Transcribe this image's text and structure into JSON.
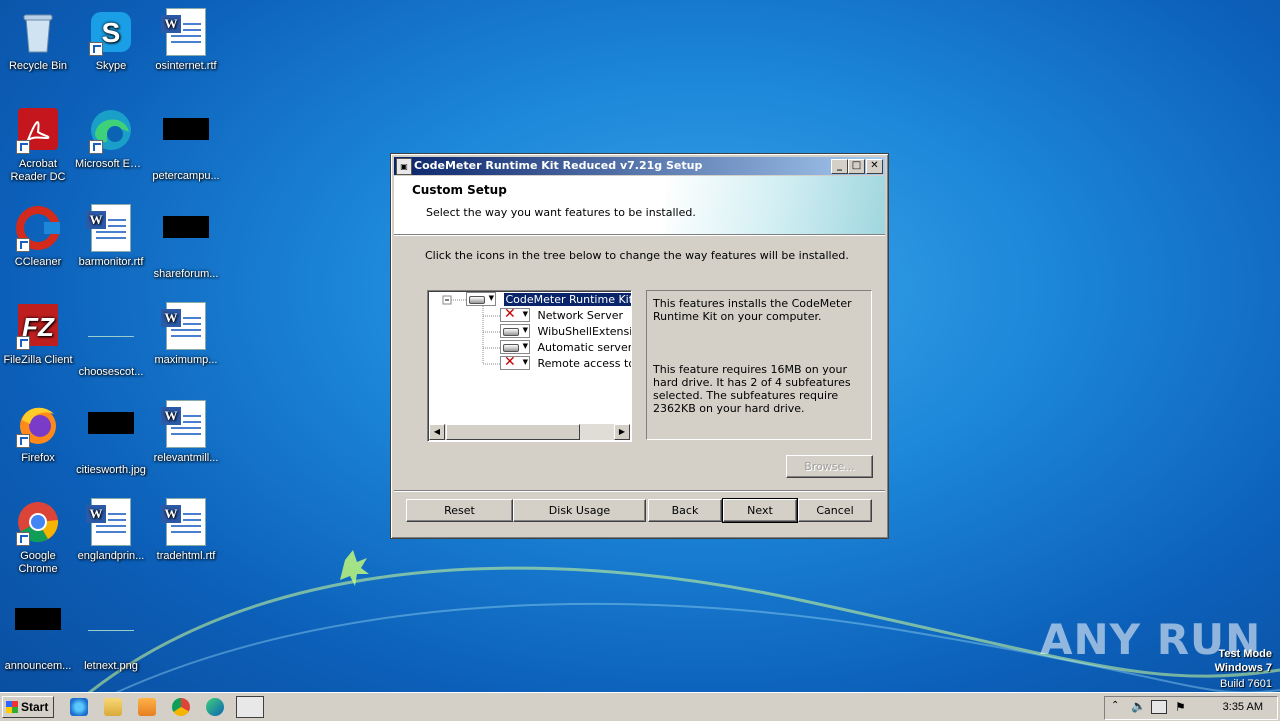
{
  "desktop": {
    "icons": [
      {
        "label": "Recycle Bin"
      },
      {
        "label": "Skype"
      },
      {
        "label": "osinternet.rtf"
      },
      {
        "label": "Acrobat Reader DC"
      },
      {
        "label": "Microsoft Edge"
      },
      {
        "label": "petercampu..."
      },
      {
        "label": "CCleaner"
      },
      {
        "label": "barmonitor.rtf"
      },
      {
        "label": "shareforum..."
      },
      {
        "label": "FileZilla Client"
      },
      {
        "label": "choosescot..."
      },
      {
        "label": "maximump..."
      },
      {
        "label": "Firefox"
      },
      {
        "label": "citiesworth.jpg"
      },
      {
        "label": "relevantmill..."
      },
      {
        "label": "Google Chrome"
      },
      {
        "label": "englandprin..."
      },
      {
        "label": "tradehtml.rtf"
      },
      {
        "label": "announcem..."
      },
      {
        "label": "letnext.png"
      }
    ]
  },
  "dialog": {
    "title": "CodeMeter Runtime Kit Reduced v7.21g Setup",
    "heading": "Custom Setup",
    "subheading": "Select the way you want features to be installed.",
    "instruction": "Click the icons in the tree below to change the way features will be installed.",
    "tree": {
      "root": "CodeMeter Runtime Kit",
      "children": [
        {
          "label": "Network Server",
          "state": "not-installed"
        },
        {
          "label": "WibuShellExtension",
          "state": "installed"
        },
        {
          "label": "Automatic server s",
          "state": "installed"
        },
        {
          "label": "Remote access to W",
          "state": "not-installed"
        }
      ]
    },
    "description": "This features installs the CodeMeter Runtime Kit on your computer.",
    "requirements": "This feature requires 16MB on your hard drive. It has 2 of 4 subfeatures selected. The subfeatures require 2362KB on your hard drive.",
    "buttons": {
      "browse": "Browse...",
      "reset": "Reset",
      "disk_usage": "Disk Usage",
      "back": "Back",
      "next": "Next",
      "cancel": "Cancel"
    }
  },
  "taskbar": {
    "start_label": "Start",
    "clock": "3:35 AM"
  },
  "watermark": {
    "brand": "ANY RUN",
    "mode": "Test Mode",
    "os": "Windows 7",
    "build": "Build 7601"
  },
  "colors": {
    "accent_title": "#0a246a",
    "desktop_blue": "#1c86d8"
  }
}
